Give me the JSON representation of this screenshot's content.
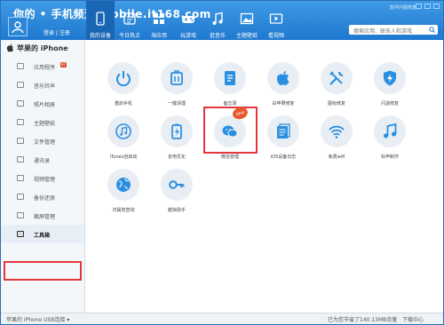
{
  "watermark": "你的 • 手机频道 mobile.it168.com",
  "login": "登录 | 注册",
  "top_right": "软件问题修复",
  "search": {
    "placeholder": "搜索应用、联系人和游戏"
  },
  "nav": [
    {
      "label": "我的设备",
      "icon": "phone-icon"
    },
    {
      "label": "今日热点",
      "icon": "hot-icon"
    },
    {
      "label": "海应用",
      "icon": "app-icon"
    },
    {
      "label": "玩游戏",
      "icon": "game-icon"
    },
    {
      "label": "逛音乐",
      "icon": "music-icon"
    },
    {
      "label": "主题壁纸",
      "icon": "wallpaper-icon"
    },
    {
      "label": "看视频",
      "icon": "video-icon"
    }
  ],
  "device_name": "苹果的 iPhone",
  "sidebar": [
    {
      "label": "应用程序",
      "badge": "87",
      "icon": "apps-icon"
    },
    {
      "label": "音乐铃声",
      "icon": "music-note-icon"
    },
    {
      "label": "照片相册",
      "icon": "photo-icon"
    },
    {
      "label": "主题壁纸",
      "icon": "theme-icon"
    },
    {
      "label": "文件管理",
      "icon": "folder-icon"
    },
    {
      "label": "通讯录",
      "icon": "contacts-icon"
    },
    {
      "label": "视频管理",
      "icon": "video-manage-icon"
    },
    {
      "label": "备份还原",
      "icon": "backup-icon"
    },
    {
      "label": "截屏管理",
      "icon": "screenshot-icon"
    },
    {
      "label": "工具箱",
      "icon": "toolbox-icon",
      "selected": true
    }
  ],
  "tools": [
    {
      "label": "重启手机",
      "icon": "power-icon"
    },
    {
      "label": "一键清理",
      "icon": "clean-icon"
    },
    {
      "label": "备忘录",
      "icon": "memo-icon"
    },
    {
      "label": "白苹果修复",
      "icon": "apple-icon"
    },
    {
      "label": "图标修复",
      "icon": "wrench-icon"
    },
    {
      "label": "闪退修复",
      "icon": "shield-bolt-icon"
    },
    {
      "label": "iTunes自启动",
      "icon": "itunes-icon"
    },
    {
      "label": "省电优化",
      "icon": "battery-icon"
    },
    {
      "label": "微信管理",
      "icon": "wechat-icon",
      "badge": "NEW"
    },
    {
      "label": "iOS设备日志",
      "icon": "log-icon"
    },
    {
      "label": "免费wifi",
      "icon": "wifi-icon"
    },
    {
      "label": "铃声制作",
      "icon": "ringtone-icon"
    },
    {
      "label": "归属地查询",
      "icon": "globe-icon"
    },
    {
      "label": "越狱助手",
      "icon": "key-icon"
    }
  ],
  "status": {
    "left": "苹果的 iPhone  USB连接 ▾",
    "mid": "已为您节省了140.13MB流量",
    "right": "下载中心"
  },
  "colors": {
    "accent": "#1e78cf",
    "highlight": "#e4373d"
  }
}
